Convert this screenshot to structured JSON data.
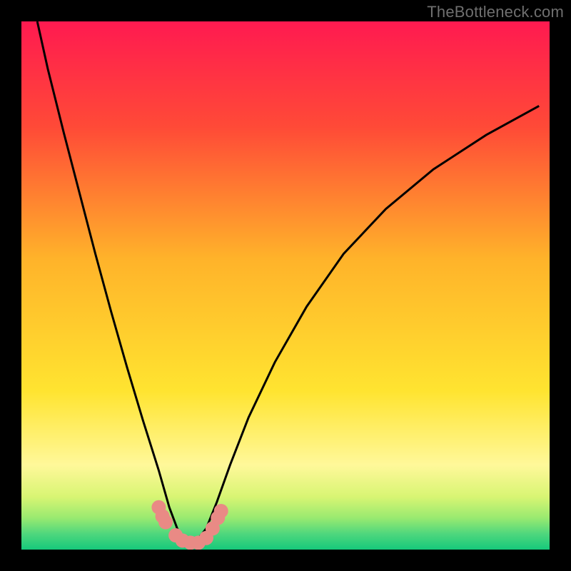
{
  "watermark": "TheBottleneck.com",
  "palette": {
    "background": "#000000",
    "curve": "#000000",
    "markers": "#e98a85"
  },
  "chart_data": {
    "type": "line",
    "title": "",
    "xlabel": "",
    "ylabel": "",
    "xlim": [
      0,
      100
    ],
    "ylim": [
      0,
      100
    ],
    "curve": {
      "type": "V-shape",
      "x": [
        3.0,
        5.0,
        8.0,
        11.0,
        14.0,
        17.0,
        20.0,
        23.0,
        26.0,
        28.0,
        29.5,
        31.0,
        33.0,
        35.0,
        37.0,
        39.5,
        43.0,
        48.0,
        54.0,
        61.0,
        69.0,
        78.0,
        88.0,
        98.0
      ],
      "y": [
        100.0,
        91.0,
        79.0,
        67.5,
        56.0,
        45.0,
        34.5,
        24.5,
        15.0,
        8.0,
        4.0,
        1.5,
        1.5,
        4.0,
        9.0,
        16.0,
        25.0,
        35.5,
        46.0,
        56.0,
        64.5,
        72.0,
        78.5,
        84.0
      ]
    },
    "markers": {
      "x": [
        26.0,
        26.7,
        27.3,
        29.2,
        30.5,
        32.0,
        33.5,
        35.0,
        36.2,
        37.2,
        37.8
      ],
      "y": [
        8.0,
        6.3,
        5.2,
        2.7,
        1.7,
        1.3,
        1.3,
        2.2,
        4.0,
        6.0,
        7.3
      ],
      "radius_px": 10
    },
    "background_gradient": {
      "stops": [
        {
          "pos": 0.0,
          "color": "#ff1a50"
        },
        {
          "pos": 0.2,
          "color": "#ff4a37"
        },
        {
          "pos": 0.45,
          "color": "#ffb32a"
        },
        {
          "pos": 0.7,
          "color": "#ffe430"
        },
        {
          "pos": 0.84,
          "color": "#fff89a"
        },
        {
          "pos": 0.9,
          "color": "#d8f573"
        },
        {
          "pos": 0.94,
          "color": "#99ea70"
        },
        {
          "pos": 0.97,
          "color": "#4fd77d"
        },
        {
          "pos": 1.0,
          "color": "#16c97b"
        }
      ]
    }
  }
}
